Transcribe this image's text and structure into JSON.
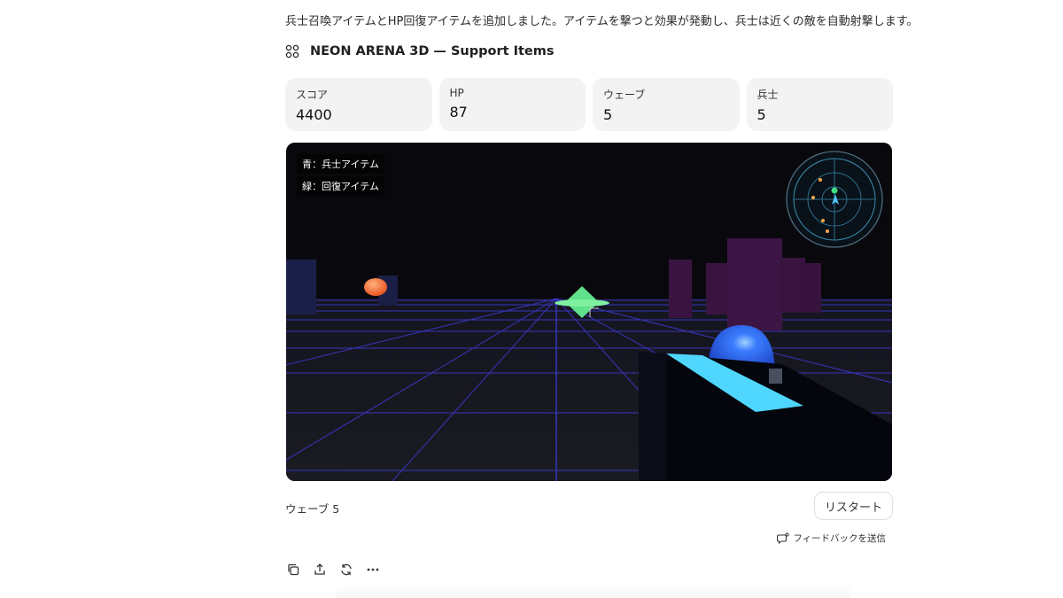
{
  "message": {
    "description": "兵士召喚アイテムとHP回復アイテムを追加しました。アイテムを撃つと効果が発動し、兵士は近くの敵を自動射撃します。"
  },
  "artifact": {
    "icon": "artifact-grid-icon",
    "title": "NEON ARENA 3D — Support Items"
  },
  "stats": [
    {
      "label": "スコア",
      "value": "4400"
    },
    {
      "label": "HP",
      "value": "87"
    },
    {
      "label": "ウェーブ",
      "value": "5"
    },
    {
      "label": "兵士",
      "value": "5"
    }
  ],
  "game": {
    "legend": [
      "青：兵士アイテム",
      "緑：回復アイテム"
    ],
    "radar": {
      "player_color": "#4fc3f7",
      "ally_color": "#3ddc84",
      "enemy_color": "#ffa64d"
    },
    "colors": {
      "grid": "#3d3bd6",
      "heal_item": "#5fe08a",
      "enemy": "#ff7a3d",
      "soldier_item": "#2f5fe0",
      "gun_stripe": "#4fd6ff"
    }
  },
  "footer": {
    "wave_text": "ウェーブ 5",
    "restart_label": "リスタート",
    "feedback_label": "フィードバックを送信"
  },
  "actions": [
    {
      "icon": "copy-icon"
    },
    {
      "icon": "share-icon"
    },
    {
      "icon": "retry-icon"
    },
    {
      "icon": "more-icon"
    }
  ]
}
